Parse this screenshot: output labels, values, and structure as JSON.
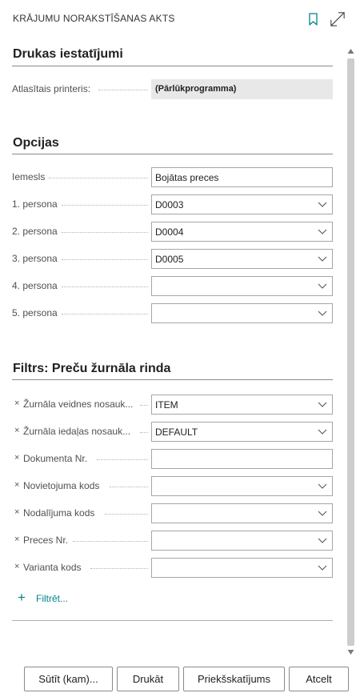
{
  "header": {
    "title": "KRĀJUMU NORAKSTĪŠANAS AKTS",
    "accent_color": "#008489"
  },
  "print_settings": {
    "title": "Drukas iestatījumi",
    "printer_label": "Atlasītais printeris:",
    "printer_value": "(Pārlūkprogramma)"
  },
  "options": {
    "title": "Opcijas",
    "fields": [
      {
        "label": "Iemesls",
        "value": "Bojātas preces",
        "type": "text"
      },
      {
        "label": "1. persona",
        "value": "D0003",
        "type": "select"
      },
      {
        "label": "2. persona",
        "value": "D0004",
        "type": "select"
      },
      {
        "label": "3. persona",
        "value": "D0005",
        "type": "select"
      },
      {
        "label": "4. persona",
        "value": "",
        "type": "select"
      },
      {
        "label": "5. persona",
        "value": "",
        "type": "select"
      }
    ]
  },
  "filters": {
    "title": "Filtrs: Preču žurnāla rinda",
    "remove_symbol": "×",
    "fields": [
      {
        "label": "Žurnāla veidnes nosauk...",
        "value": "ITEM",
        "type": "select"
      },
      {
        "label": "Žurnāla iedaļas nosauk...",
        "value": "DEFAULT",
        "type": "select"
      },
      {
        "label": "Dokumenta Nr.",
        "value": "",
        "type": "text"
      },
      {
        "label": "Novietojuma kods",
        "value": "",
        "type": "select"
      },
      {
        "label": "Nodalījuma kods",
        "value": "",
        "type": "select"
      },
      {
        "label": "Preces Nr.",
        "value": "",
        "type": "select"
      },
      {
        "label": "Varianta kods",
        "value": "",
        "type": "select"
      }
    ],
    "add_filter_label": "Filtrēt..."
  },
  "footer": {
    "send_label": "Sūtīt (kam)...",
    "print_label": "Drukāt",
    "preview_label": "Priekšskatījums",
    "cancel_label": "Atcelt"
  }
}
